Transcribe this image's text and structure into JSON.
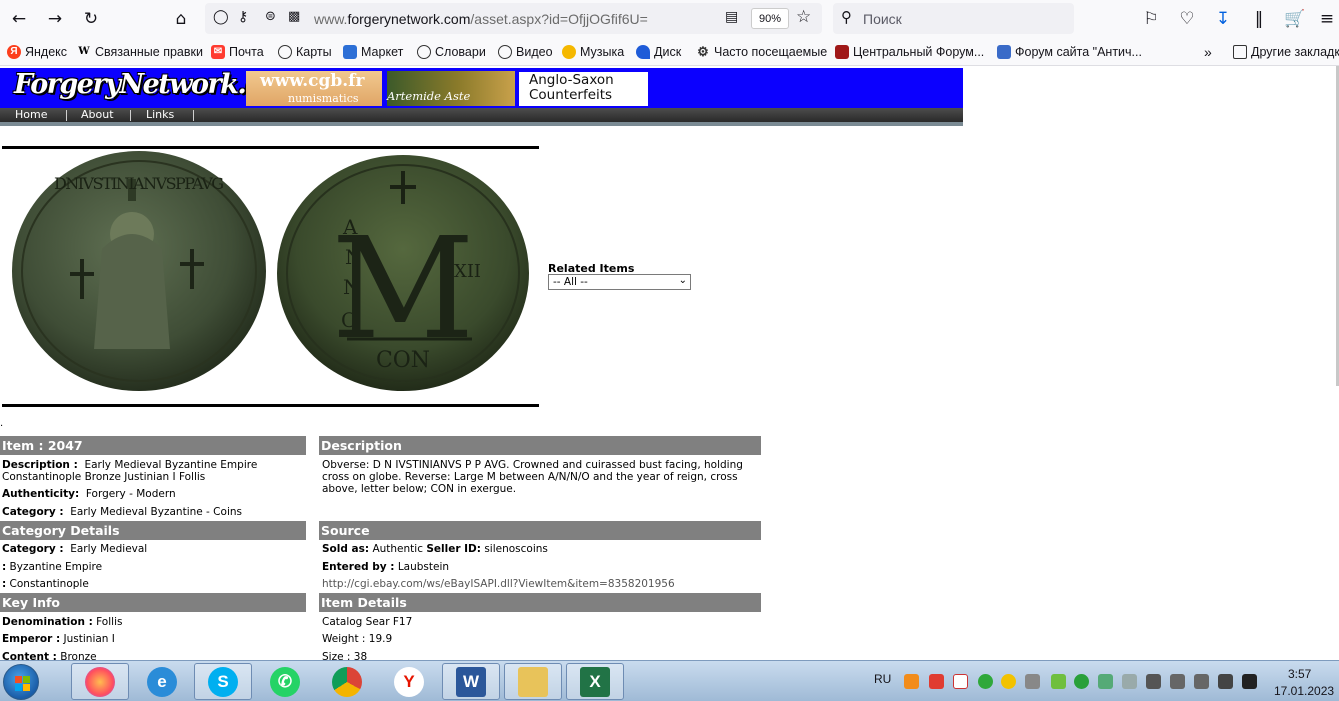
{
  "browser": {
    "url_prefix": "www.",
    "url_host": "forgerynetwork.com",
    "url_path": "/asset.aspx?id=OfjjOGfif6U=",
    "zoom": "90%",
    "search_placeholder": "Поиск"
  },
  "bookmarks": [
    {
      "label": "Яндекс",
      "icon": "yandex-icon"
    },
    {
      "label": "Связанные правки",
      "icon": "wikipedia-icon"
    },
    {
      "label": "Почта",
      "icon": "mail-icon"
    },
    {
      "label": "Карты",
      "icon": "globe-icon"
    },
    {
      "label": "Маркет",
      "icon": "market-icon"
    },
    {
      "label": "Словари",
      "icon": "globe-icon"
    },
    {
      "label": "Видео",
      "icon": "globe-icon"
    },
    {
      "label": "Музыка",
      "icon": "music-icon"
    },
    {
      "label": "Диск",
      "icon": "disk-icon"
    },
    {
      "label": "Часто посещаемые",
      "icon": "gear-icon"
    },
    {
      "label": "Центральный Форум...",
      "icon": "forum-icon"
    },
    {
      "label": "Форум сайта \"Антич...",
      "icon": "forum-icon"
    },
    {
      "label": "Другие закладки",
      "icon": "folder-icon"
    }
  ],
  "site": {
    "logo": "ForgeryNetwork.com",
    "ad1": "www.cgb.fr",
    "ad1_sub": "numismatics",
    "ad2": "Artemide Aste",
    "ad3_line1": "Anglo-Saxon",
    "ad3_line2": "Counterfeits",
    "nav": [
      "Home",
      "About",
      "Links"
    ]
  },
  "coin": {
    "obverse_legend": "DNIVSTINIANVSPPAVG",
    "reverse_letters": [
      "A",
      "N",
      "N",
      "O",
      "M",
      "XII",
      "CON"
    ]
  },
  "related": {
    "label": "Related Items",
    "value": "-- All --"
  },
  "dot": ".",
  "item": {
    "header": "Item : 2047",
    "description_label": "Description :",
    "description_line1": "Early Medieval Byzantine Empire",
    "description_line2": "Constantinople Bronze Justinian I Follis",
    "authenticity_label": "Authenticity:",
    "authenticity": "Forgery - Modern",
    "category_label": "Category :",
    "category": "Early Medieval Byzantine - Coins"
  },
  "description_panel": {
    "header": "Description",
    "text": "Obverse: D N IVSTINIANVS P P AVG. Crowned and cuirassed bust facing, holding cross on globe. Reverse: Large M between A/N/N/O and the year of reign, cross above, letter below; CON in exergue."
  },
  "category_details": {
    "header": "Category Details",
    "category_label": "Category :",
    "category": "Early Medieval",
    "row2_label": ":",
    "row2": "Byzantine Empire",
    "row3_label": ":",
    "row3": "Constantinople"
  },
  "source": {
    "header": "Source",
    "sold_as_label": "Sold as:",
    "sold_as": "Authentic",
    "seller_label": "Seller ID:",
    "seller": "silenoscoins",
    "entered_label": "Entered by :",
    "entered": "Laubstein",
    "link": "http://cgi.ebay.com/ws/eBayISAPI.dll?ViewItem&item=8358201956"
  },
  "key_info": {
    "header": "Key Info",
    "denomination_label": "Denomination :",
    "denomination": "Follis",
    "emperor_label": "Emperor :",
    "emperor": "Justinian I",
    "content_label": "Content :",
    "content": "Bronze"
  },
  "item_details": {
    "header": "Item Details",
    "catalog": "Catalog Sear F17",
    "weight": "Weight : 19.9",
    "size": "Size : 38"
  },
  "taskbar": {
    "apps": [
      "firefox-icon",
      "internet-explorer-icon",
      "skype-icon",
      "whatsapp-icon",
      "chrome-icon",
      "yandex-browser-icon",
      "word-icon",
      "file-explorer-icon",
      "excel-icon"
    ],
    "lang": "RU",
    "time": "3:57",
    "date": "17.01.2023"
  },
  "colors": {
    "banner_blue": "#0b00ff",
    "section_header_gray": "#808080"
  }
}
